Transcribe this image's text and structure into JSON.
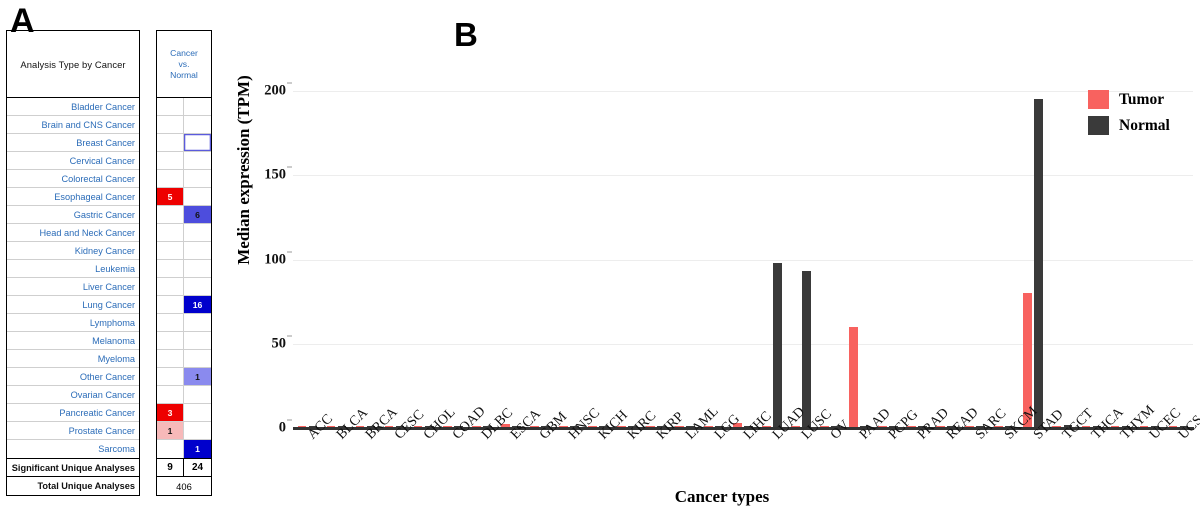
{
  "panels": {
    "a_letter": "A",
    "b_letter": "B"
  },
  "table": {
    "header_left": "Analysis Type by Cancer",
    "header_right": "Cancer\nvs.\nNormal",
    "header_right_lines": [
      "Cancer",
      "vs.",
      "Normal"
    ],
    "rows": [
      {
        "label": "Bladder Cancer",
        "left": {
          "value": "",
          "color": "#ffffff"
        },
        "right": {
          "value": "",
          "color": "#ffffff"
        }
      },
      {
        "label": "Brain and CNS Cancer",
        "left": {
          "value": "",
          "color": "#ffffff"
        },
        "right": {
          "value": "",
          "color": "#ffffff"
        }
      },
      {
        "label": "Breast Cancer",
        "left": {
          "value": "",
          "color": "#ffffff"
        },
        "right": {
          "value": "",
          "color": "#ffffff",
          "outline": "#5b5bdc"
        }
      },
      {
        "label": "Cervical Cancer",
        "left": {
          "value": "",
          "color": "#ffffff"
        },
        "right": {
          "value": "",
          "color": "#ffffff"
        }
      },
      {
        "label": "Colorectal Cancer",
        "left": {
          "value": "",
          "color": "#ffffff"
        },
        "right": {
          "value": "",
          "color": "#ffffff"
        }
      },
      {
        "label": "Esophageal Cancer",
        "left": {
          "value": "5",
          "color": "#ee0000",
          "text": "#ffffff"
        },
        "right": {
          "value": "",
          "color": "#ffffff"
        }
      },
      {
        "label": "Gastric Cancer",
        "left": {
          "value": "",
          "color": "#ffffff"
        },
        "right": {
          "value": "6",
          "color": "#4d4ddd",
          "text": "#111111"
        }
      },
      {
        "label": "Head and Neck Cancer",
        "left": {
          "value": "",
          "color": "#ffffff"
        },
        "right": {
          "value": "",
          "color": "#ffffff"
        }
      },
      {
        "label": "Kidney Cancer",
        "left": {
          "value": "",
          "color": "#ffffff"
        },
        "right": {
          "value": "",
          "color": "#ffffff"
        }
      },
      {
        "label": "Leukemia",
        "left": {
          "value": "",
          "color": "#ffffff"
        },
        "right": {
          "value": "",
          "color": "#ffffff"
        }
      },
      {
        "label": "Liver Cancer",
        "left": {
          "value": "",
          "color": "#ffffff"
        },
        "right": {
          "value": "",
          "color": "#ffffff"
        }
      },
      {
        "label": "Lung Cancer",
        "left": {
          "value": "",
          "color": "#ffffff"
        },
        "right": {
          "value": "16",
          "color": "#0000cc",
          "text": "#ffffff"
        }
      },
      {
        "label": "Lymphoma",
        "left": {
          "value": "",
          "color": "#ffffff"
        },
        "right": {
          "value": "",
          "color": "#ffffff"
        }
      },
      {
        "label": "Melanoma",
        "left": {
          "value": "",
          "color": "#ffffff"
        },
        "right": {
          "value": "",
          "color": "#ffffff"
        }
      },
      {
        "label": "Myeloma",
        "left": {
          "value": "",
          "color": "#ffffff"
        },
        "right": {
          "value": "",
          "color": "#ffffff"
        }
      },
      {
        "label": "Other Cancer",
        "left": {
          "value": "",
          "color": "#ffffff"
        },
        "right": {
          "value": "1",
          "color": "#8a8aee",
          "text": "#111111"
        }
      },
      {
        "label": "Ovarian Cancer",
        "left": {
          "value": "",
          "color": "#ffffff"
        },
        "right": {
          "value": "",
          "color": "#ffffff"
        }
      },
      {
        "label": "Pancreatic Cancer",
        "left": {
          "value": "3",
          "color": "#ee0000",
          "text": "#ffffff"
        },
        "right": {
          "value": "",
          "color": "#ffffff"
        }
      },
      {
        "label": "Prostate Cancer",
        "left": {
          "value": "1",
          "color": "#f7b9b9",
          "text": "#111111"
        },
        "right": {
          "value": "",
          "color": "#ffffff"
        }
      },
      {
        "label": "Sarcoma",
        "left": {
          "value": "",
          "color": "#ffffff"
        },
        "right": {
          "value": "1",
          "color": "#0000cc",
          "text": "#ffffff"
        }
      }
    ],
    "summary": {
      "significant_label": "Significant Unique Analyses",
      "significant_left": "9",
      "significant_right": "24",
      "total_label": "Total Unique Analyses",
      "total_value": "406"
    }
  },
  "chart_data": {
    "type": "bar",
    "title": "",
    "xlabel": "Cancer types",
    "ylabel": "Median expression (TPM)",
    "ylim": [
      0,
      200
    ],
    "yticks": [
      0,
      50,
      100,
      150,
      200
    ],
    "grid": true,
    "legend_position": "top-right",
    "categories": [
      "ACC",
      "BLCA",
      "BRCA",
      "CESC",
      "CHOL",
      "COAD",
      "DLBC",
      "ESCA",
      "GBM",
      "HNSC",
      "KICH",
      "KIRC",
      "KIRP",
      "LAML",
      "LGG",
      "LIHC",
      "LUAD",
      "LUSC",
      "OV",
      "PAAD",
      "PCPG",
      "PRAD",
      "READ",
      "SARC",
      "SKCM",
      "STAD",
      "TGCT",
      "THCA",
      "THYM",
      "UCEC",
      "UCS"
    ],
    "series": [
      {
        "name": "Tumor",
        "color": "#f8625f",
        "values": [
          0.3,
          0.4,
          0.4,
          0.3,
          0.5,
          0.4,
          0.2,
          2.2,
          0.2,
          0.5,
          0.3,
          0.4,
          0.3,
          0.2,
          0.2,
          3.0,
          0.6,
          0.5,
          0.3,
          60,
          0.4,
          0.5,
          0.4,
          0.3,
          0.3,
          80,
          0.6,
          0.4,
          0.3,
          0.4,
          0.3
        ]
      },
      {
        "name": "Normal",
        "color": "#3a3a3a",
        "values": [
          0,
          0.3,
          0.3,
          0.2,
          0.4,
          0.3,
          0,
          0.4,
          0,
          0.3,
          0.3,
          0.3,
          0.3,
          0,
          0,
          0.5,
          98,
          93,
          0,
          0.4,
          0.3,
          0.4,
          0.3,
          0,
          0,
          195,
          2.0,
          0.3,
          0,
          0.3,
          0
        ]
      }
    ]
  },
  "legend": {
    "items": [
      {
        "label": "Tumor",
        "color": "#f8625f"
      },
      {
        "label": "Normal",
        "color": "#3a3a3a"
      }
    ]
  }
}
